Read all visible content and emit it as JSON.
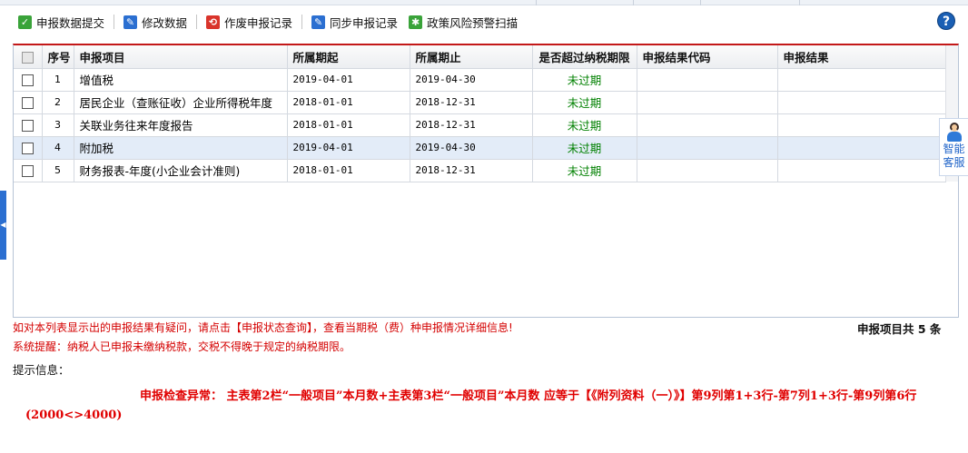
{
  "toolbar": {
    "buttons": [
      {
        "label": "申报数据提交",
        "icon": "checkmark-icon",
        "color": "#3aa33a"
      },
      {
        "label": "修改数据",
        "icon": "edit-icon",
        "color": "#2b6fd1"
      },
      {
        "label": "作废申报记录",
        "icon": "void-icon",
        "color": "#d9342b"
      },
      {
        "label": "同步申报记录",
        "icon": "sync-icon",
        "color": "#2b6fd1"
      },
      {
        "label": "政策风险预警扫描",
        "icon": "scan-icon",
        "color": "#3aa33a"
      }
    ],
    "help_symbol": "?"
  },
  "grid": {
    "headers": {
      "no": "序号",
      "item": "申报项目",
      "start": "所属期起",
      "end": "所属期止",
      "overdue": "是否超过纳税期限",
      "result_code": "申报结果代码",
      "result": "申报结果"
    },
    "rows": [
      {
        "no": "1",
        "item": "增值税",
        "start": "2019-04-01",
        "end": "2019-04-30",
        "overdue": "未过期",
        "result_code": "",
        "result": ""
      },
      {
        "no": "2",
        "item": "居民企业（查账征收）企业所得税年度",
        "start": "2018-01-01",
        "end": "2018-12-31",
        "overdue": "未过期",
        "result_code": "",
        "result": ""
      },
      {
        "no": "3",
        "item": "关联业务往来年度报告",
        "start": "2018-01-01",
        "end": "2018-12-31",
        "overdue": "未过期",
        "result_code": "",
        "result": ""
      },
      {
        "no": "4",
        "item": "附加税",
        "start": "2019-04-01",
        "end": "2019-04-30",
        "overdue": "未过期",
        "result_code": "",
        "result": ""
      },
      {
        "no": "5",
        "item": "财务报表-年度(小企业会计准则)",
        "start": "2018-01-01",
        "end": "2018-12-31",
        "overdue": "未过期",
        "result_code": "",
        "result": ""
      }
    ],
    "selected_row": 4
  },
  "notes": {
    "query_hint": "如对本列表显示出的申报结果有疑问，请点击【申报状态查询】，查看当期税（费）种申报情况详细信息!",
    "system_reminder": "系统提醒：纳税人已申报未缴纳税款，交税不得晚于规定的纳税期限。",
    "count_text": "申报项目共 5 条",
    "tips_label": "提示信息：",
    "error_message": "申报检查异常： 主表第2栏“一般项目”本月数+主表第3栏“一般项目”本月数 应等于【《附列资料（一）》】第9列第1+3行-第7列1+3行-第9列第6行(2000<>4000)"
  },
  "assistant": {
    "line1": "智能",
    "line2": "客服",
    "icon": "customer-service-avatar-icon"
  },
  "colors": {
    "accent_red": "#c31818",
    "status_green": "#008000",
    "error_red": "#e00000",
    "brand_blue": "#2b6fd1"
  }
}
